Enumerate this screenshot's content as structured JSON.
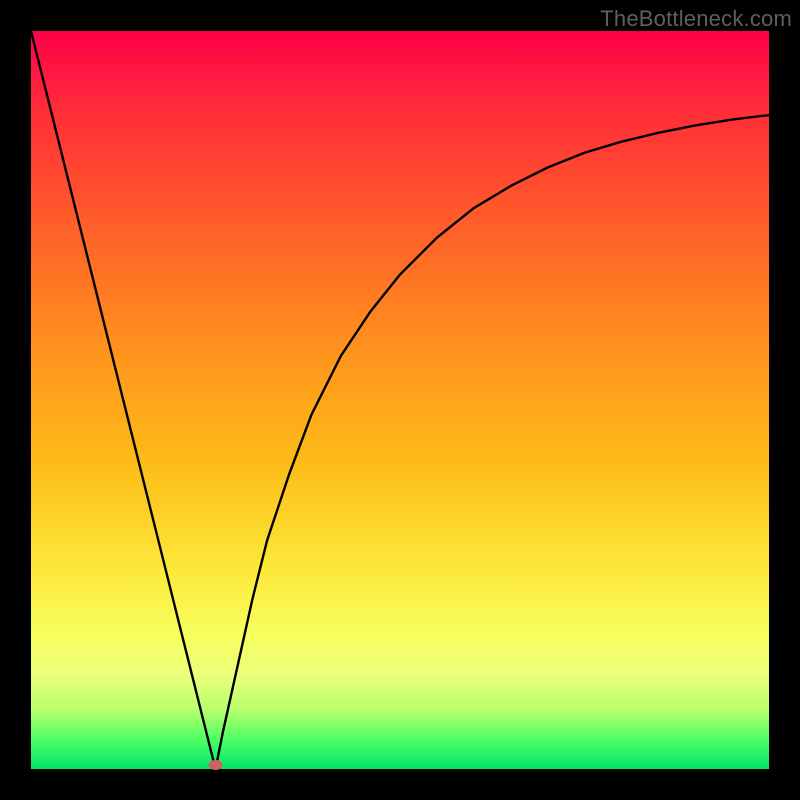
{
  "watermark": {
    "text": "TheBottleneck.com"
  },
  "colors": {
    "gradient_top": "#ff0048",
    "gradient_mid": "#fdbb16",
    "gradient_yellow": "#f7ff60",
    "gradient_bottom": "#00e56a",
    "frame": "#000000",
    "curve": "#000000",
    "marker": "#d26060"
  },
  "chart_data": {
    "type": "line",
    "title": "",
    "xlabel": "",
    "ylabel": "",
    "xlim": [
      0,
      100
    ],
    "ylim": [
      0,
      100
    ],
    "marker": {
      "x": 25,
      "y": 0
    },
    "series": [
      {
        "name": "curve",
        "x": [
          0,
          2,
          4,
          6,
          8,
          10,
          12,
          14,
          16,
          18,
          20,
          22,
          24,
          25,
          26,
          28,
          30,
          32,
          35,
          38,
          42,
          46,
          50,
          55,
          60,
          65,
          70,
          75,
          80,
          85,
          90,
          95,
          100
        ],
        "y": [
          100,
          92,
          84,
          76,
          68,
          60,
          52,
          44,
          36,
          28,
          20,
          12,
          4,
          0,
          5,
          14,
          23,
          31,
          40,
          48,
          56,
          62,
          67,
          72,
          76,
          79,
          81.5,
          83.5,
          85,
          86.2,
          87.2,
          88,
          88.6
        ]
      }
    ]
  }
}
